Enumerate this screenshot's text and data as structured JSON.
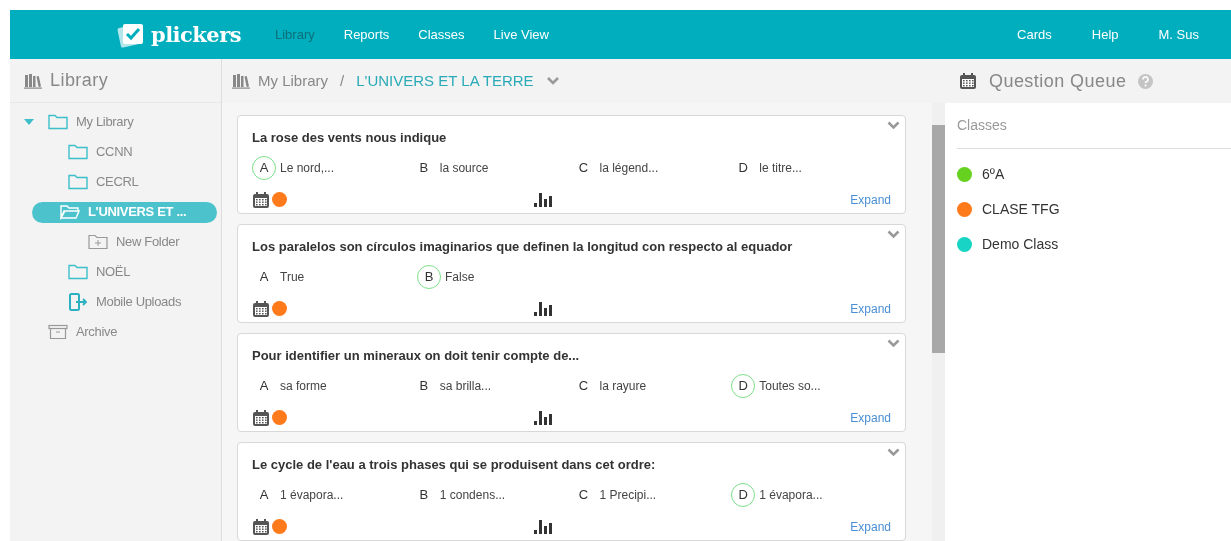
{
  "header": {
    "logo": "plickers",
    "nav": [
      {
        "label": "Library",
        "selected": true
      },
      {
        "label": "Reports",
        "selected": false
      },
      {
        "label": "Classes",
        "selected": false
      },
      {
        "label": "Live View",
        "selected": false
      }
    ],
    "right_nav": [
      "Cards",
      "Help",
      "M. Sus"
    ]
  },
  "sidebar": {
    "title": "Library",
    "tree": [
      {
        "label": "My Library",
        "kind": "folder",
        "expanded": true,
        "selected": false,
        "children": [
          {
            "label": "CCNN",
            "kind": "folder",
            "selected": false
          },
          {
            "label": "CECRL",
            "kind": "folder",
            "selected": false
          },
          {
            "label": "L'UNIVERS ET ...",
            "kind": "folder",
            "selected": true,
            "children": [
              {
                "label": "New Folder",
                "kind": "new-folder",
                "selected": false
              }
            ]
          },
          {
            "label": "NOËL",
            "kind": "folder",
            "selected": false
          },
          {
            "label": "Mobile Uploads",
            "kind": "upload",
            "selected": false
          }
        ]
      },
      {
        "label": "Archive",
        "kind": "archive",
        "selected": false
      }
    ]
  },
  "breadcrumb": {
    "root": "My Library",
    "separator": "/",
    "current": "L'UNIVERS ET LA TERRE"
  },
  "questions": [
    {
      "text": "La rose des vents nous indique",
      "color": "#ff7a1a",
      "expand": "Expand",
      "answers": [
        {
          "letter": "A",
          "text": "Le nord,...",
          "correct": true
        },
        {
          "letter": "B",
          "text": "la source",
          "correct": false
        },
        {
          "letter": "C",
          "text": "la légend...",
          "correct": false
        },
        {
          "letter": "D",
          "text": "le titre...",
          "correct": false
        }
      ]
    },
    {
      "text": "Los paralelos son círculos imaginarios que definen la longitud con respecto al equador",
      "color": "#ff7a1a",
      "expand": "Expand",
      "answers": [
        {
          "letter": "A",
          "text": "True",
          "correct": false
        },
        {
          "letter": "B",
          "text": "False",
          "correct": true
        }
      ]
    },
    {
      "text": "Pour identifier un mineraux on doit tenir compte de...",
      "color": "#ff7a1a",
      "expand": "Expand",
      "answers": [
        {
          "letter": "A",
          "text": "sa forme",
          "correct": false
        },
        {
          "letter": "B",
          "text": "sa brilla...",
          "correct": false
        },
        {
          "letter": "C",
          "text": "la rayure",
          "correct": false
        },
        {
          "letter": "D",
          "text": "Toutes so...",
          "correct": true
        }
      ]
    },
    {
      "text": "Le cycle de l'eau a trois phases qui se produisent dans cet ordre:",
      "color": "#ff7a1a",
      "expand": "Expand",
      "answers": [
        {
          "letter": "A",
          "text": "1 évapora...",
          "correct": false
        },
        {
          "letter": "B",
          "text": "1 condens...",
          "correct": false
        },
        {
          "letter": "C",
          "text": "1 Precipi...",
          "correct": false
        },
        {
          "letter": "D",
          "text": "1 évapora...",
          "correct": true
        }
      ]
    }
  ],
  "queue": {
    "title": "Question Queue",
    "section": "Classes",
    "classes": [
      {
        "name": "6ºA",
        "color": "#66d11f"
      },
      {
        "name": "CLASE TFG",
        "color": "#ff7a1a"
      },
      {
        "name": "Demo Class",
        "color": "#17d4c4"
      }
    ]
  }
}
